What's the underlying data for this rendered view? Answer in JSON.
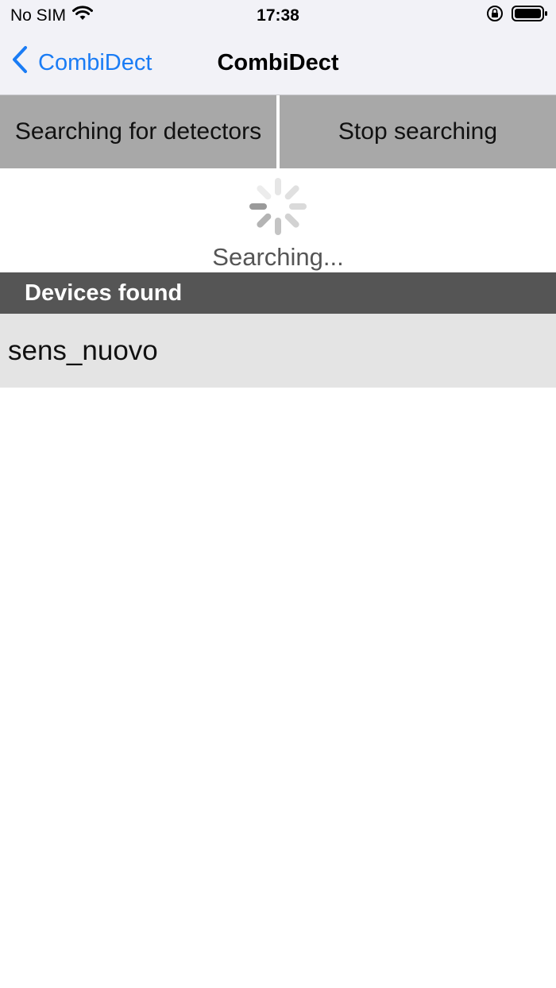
{
  "status_bar": {
    "carrier": "No SIM",
    "time": "17:38",
    "wifi_icon": "wifi-icon",
    "lock_icon": "orientation-lock-icon",
    "battery_icon": "battery-icon"
  },
  "nav": {
    "back_label": "CombiDect",
    "title": "CombiDect",
    "back_icon": "chevron-left-icon",
    "accent_color": "#1a7cf5"
  },
  "actions": {
    "search_label": "Searching for detectors",
    "stop_label": "Stop searching"
  },
  "searching": {
    "text": "Searching..."
  },
  "devices": {
    "header": "Devices found",
    "items": [
      {
        "name": "sens_nuovo"
      }
    ]
  }
}
